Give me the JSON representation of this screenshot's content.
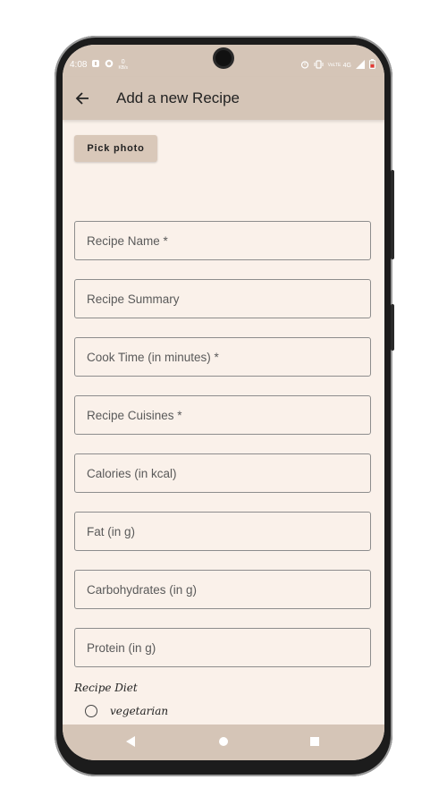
{
  "status_bar": {
    "time": "4:08",
    "left_icons": [
      "notification-icon",
      "whatsapp-icon",
      "data-speed-icon"
    ],
    "data_speed": "0",
    "data_speed_unit": "KB/s",
    "right_icons": [
      "alarm-icon",
      "vibrate-icon",
      "volte-icon",
      "signal-icon",
      "battery-icon"
    ],
    "network": "4G",
    "volte": "VoLTE"
  },
  "app_bar": {
    "title": "Add a new Recipe",
    "back_icon": "arrow-back-icon"
  },
  "pick_photo_label": "Pick photo",
  "form": {
    "fields": [
      {
        "label": "Recipe Name *",
        "value": ""
      },
      {
        "label": "Recipe Summary",
        "value": ""
      },
      {
        "label": "Cook Time (in minutes) *",
        "value": ""
      },
      {
        "label": "Recipe Cuisines *",
        "value": ""
      },
      {
        "label": "Calories (in kcal)",
        "value": ""
      },
      {
        "label": "Fat (in g)",
        "value": ""
      },
      {
        "label": "Carbohydrates (in g)",
        "value": ""
      },
      {
        "label": "Protein (in g)",
        "value": ""
      }
    ],
    "diet_label": "Recipe Diet",
    "diet_options": [
      "vegetarian"
    ]
  },
  "nav_bar": {
    "icons": [
      "back-triangle-icon",
      "home-circle-icon",
      "recents-square-icon"
    ]
  },
  "colors": {
    "app_bar": "#d5c5b7",
    "background": "#faf1ea",
    "button": "#d9c8b9",
    "field_border": "#8d8d8d"
  }
}
